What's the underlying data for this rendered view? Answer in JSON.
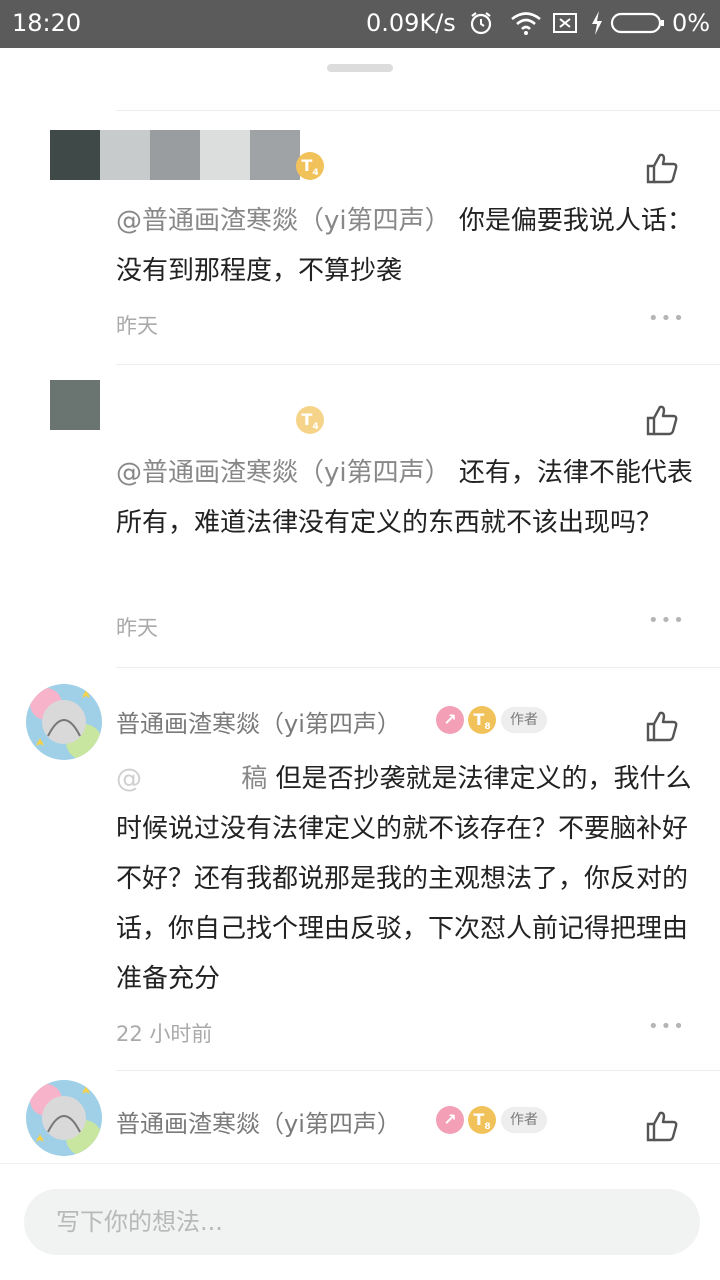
{
  "status_bar": {
    "time": "18:20",
    "network_speed": "0.09K/s",
    "battery_percent": "0%",
    "icons": [
      "alarm-icon",
      "wifi-icon",
      "sim-off-icon",
      "charging-icon",
      "battery-icon"
    ]
  },
  "comments": [
    {
      "mention": "@普通画渣寒燚（yi第四声）",
      "text": "你是偏要我说人话：没有到那程度，不算抄袭",
      "time": "昨天",
      "level": "T4"
    },
    {
      "mention": "@普通画渣寒燚（yi第四声）",
      "text": "还有，法律不能代表所有，难道法律没有定义的东西就不该出现吗？",
      "time": "昨天",
      "level": "T4"
    },
    {
      "author": "普通画渣寒燚（yi第四声）",
      "author_tag": "作者",
      "level": "T8",
      "mention_tail": "稿",
      "text_first": "但是否抄袭就是法律定义的，",
      "text_rest": "我什么时候说过没有法律定义的就不该存在？不要脑补好不好？还有我都说那是我的主观想法了，你反对的话，你自己找个理由反驳，下次怼人前记得把理由准备充分",
      "time": "22 小时前"
    },
    {
      "author": "普通画渣寒燚（yi第四声）",
      "author_tag": "作者",
      "level": "T8"
    }
  ],
  "input": {
    "placeholder": "写下你的想法..."
  },
  "colors": {
    "status_bar": "#5b5b5b",
    "level_badge": "#f2c25a",
    "pink_badge": "#f3a0b6",
    "muted_text": "#aaaaaa",
    "mention_text": "#888888"
  }
}
